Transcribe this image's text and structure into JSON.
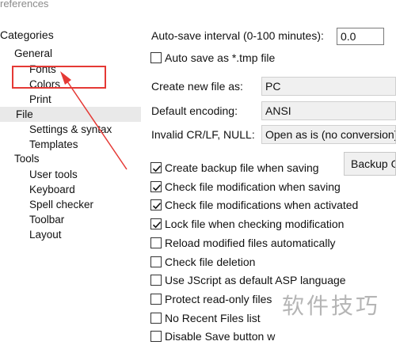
{
  "window": {
    "title": "references"
  },
  "sidebar": {
    "header": "Categories",
    "groups": [
      {
        "label": "General",
        "items": [
          "Fonts",
          "Colors",
          "Print"
        ]
      },
      {
        "label": "File",
        "items": [
          "Settings & syntax",
          "Templates"
        ]
      },
      {
        "label": "Tools",
        "items": [
          "User tools",
          "Keyboard",
          "Spell checker",
          "Toolbar",
          "Layout"
        ]
      }
    ]
  },
  "settings": {
    "autosave_label": "Auto-save interval (0-100 minutes):",
    "autosave_value": "0.0",
    "autosave_tmp": "Auto save as *.tmp file",
    "create_new_label": "Create new file as:",
    "create_new_value": "PC",
    "encoding_label": "Default encoding:",
    "encoding_value": "ANSI",
    "invalid_label": "Invalid CR/LF, NULL:",
    "invalid_value": "Open as is (no conversion)",
    "backup_button": "Backup O"
  },
  "checkboxes": [
    {
      "label": "Create backup file when saving",
      "checked": true
    },
    {
      "label": "Check file modification when saving",
      "checked": true
    },
    {
      "label": "Check file modifications when activated",
      "checked": true
    },
    {
      "label": "Lock file when checking modification",
      "checked": true
    },
    {
      "label": "Reload modified files automatically",
      "checked": false
    },
    {
      "label": "Check file deletion",
      "checked": false
    },
    {
      "label": "Use JScript as default ASP language",
      "checked": false
    },
    {
      "label": "Protect read-only files",
      "checked": false
    },
    {
      "label": "No Recent Files list",
      "checked": false
    },
    {
      "label": "Disable Save button w",
      "checked": false
    }
  ],
  "watermark": {
    "text": "软件技巧"
  },
  "colors": {
    "highlight": "#e53935",
    "selected_row": "#e9e9e9"
  }
}
